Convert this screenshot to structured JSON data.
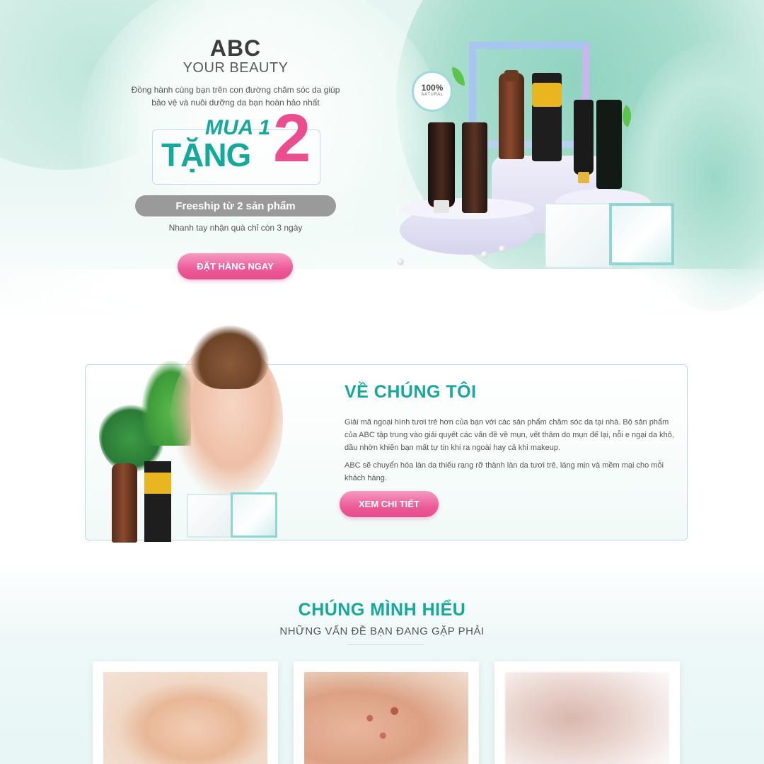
{
  "hero": {
    "brand_name": "ABC",
    "brand_tagline": "YOUR BEAUTY",
    "description": "Đồng hành cùng bạn trên con đường chăm sóc da giúp bảo vệ và nuôi dưỡng da bạn hoàn hảo nhất",
    "promo": {
      "buy": "MUA 1",
      "gift": "TẶNG",
      "number": "2"
    },
    "freeship": "Freeship từ 2 sản phẩm",
    "note": "Nhanh tay nhận quà chỉ còn 3 ngày",
    "cta": "ĐẶT HÀNG NGAY",
    "badge": {
      "percent": "100%",
      "label": "NATURAL"
    }
  },
  "about": {
    "title": "VỀ CHÚNG TÔI",
    "paragraph1": "Giải mã ngoại hình tươi trẻ hơn của bạn với các sản phẩm chăm sóc da tại nhà. Bộ sản phẩm của ABC tập trung vào giải quyết các vấn đề về mụn, vết thâm do mụn để lại, nỗi e ngại da khô, dầu nhờn khiến bạn mất tự tin khi ra ngoài hay cả khi makeup.",
    "paragraph2": "ABC sẽ chuyển hóa làn da thiếu rạng rỡ thành làn da tươi trẻ, láng mịn và mềm mại cho mỗi khách hàng.",
    "cta": "XEM CHI TIẾT"
  },
  "problems": {
    "title": "CHÚNG MÌNH HIỂU",
    "subtitle": "NHỮNG VẤN ĐỀ BẠN ĐANG GẶP PHẢI"
  },
  "colors": {
    "teal": "#14a99a",
    "pink": "#ec4d8f",
    "grey_pill": "#9a9a9a"
  }
}
